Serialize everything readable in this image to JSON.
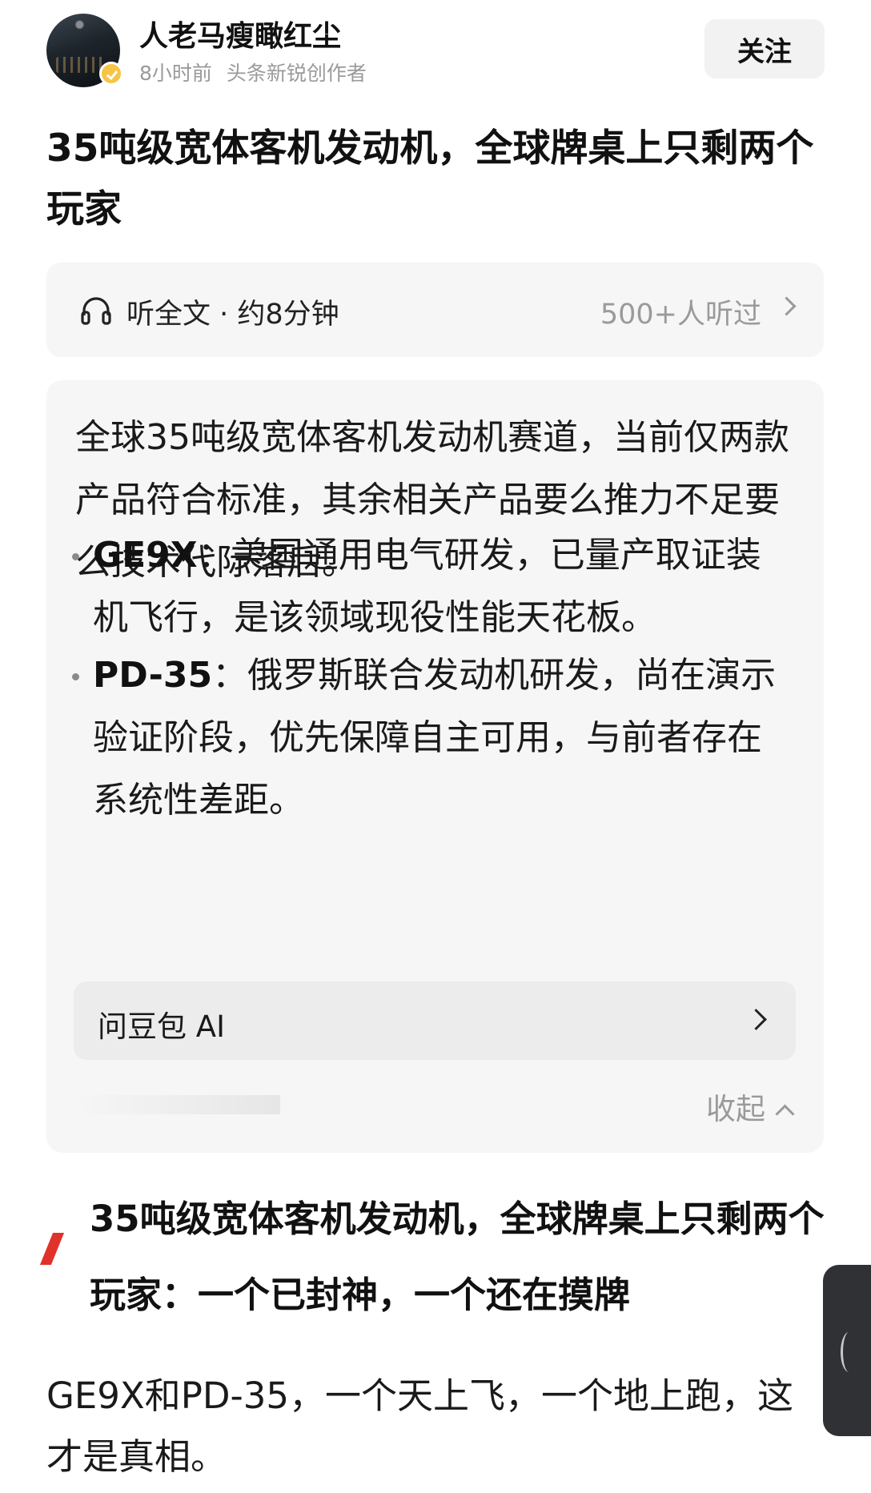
{
  "author": {
    "name": "人老马瘦瞰红尘",
    "time": "8小时前",
    "role": "头条新锐创作者",
    "follow_label": "关注"
  },
  "article": {
    "title": "35吨级宽体客机发动机，全球牌桌上只剩两个玩家"
  },
  "listen": {
    "icon": "headphones-icon",
    "label": "听全文 · 约8分钟",
    "count": "500+人听过"
  },
  "summary": {
    "intro": "全球35吨级宽体客机发动机赛道，当前仅两款产品符合标准，其余相关产品要么推力不足要么技术代际落后。",
    "bullets": [
      {
        "name": "GE9X",
        "sep": "：",
        "text": "美国通用电气研发，已量产取证装机飞行，是该领域现役性能天花板。"
      },
      {
        "name": "PD-35",
        "sep": "：",
        "text": "俄罗斯联合发动机研发，尚在演示验证阶段，优先保障自主可用，与前者存在系统性差距。"
      }
    ],
    "ask_label": "问豆包 AI",
    "collapse_label": "收起"
  },
  "section": {
    "heading": "35吨级宽体客机发动机，全球牌桌上只剩两个玩家：一个已封神，一个还在摸牌",
    "accent_color": "#e0322a"
  },
  "body": {
    "paragraph": "GE9X和PD-35，一个天上飞，一个地上跑，这才是真相。"
  }
}
